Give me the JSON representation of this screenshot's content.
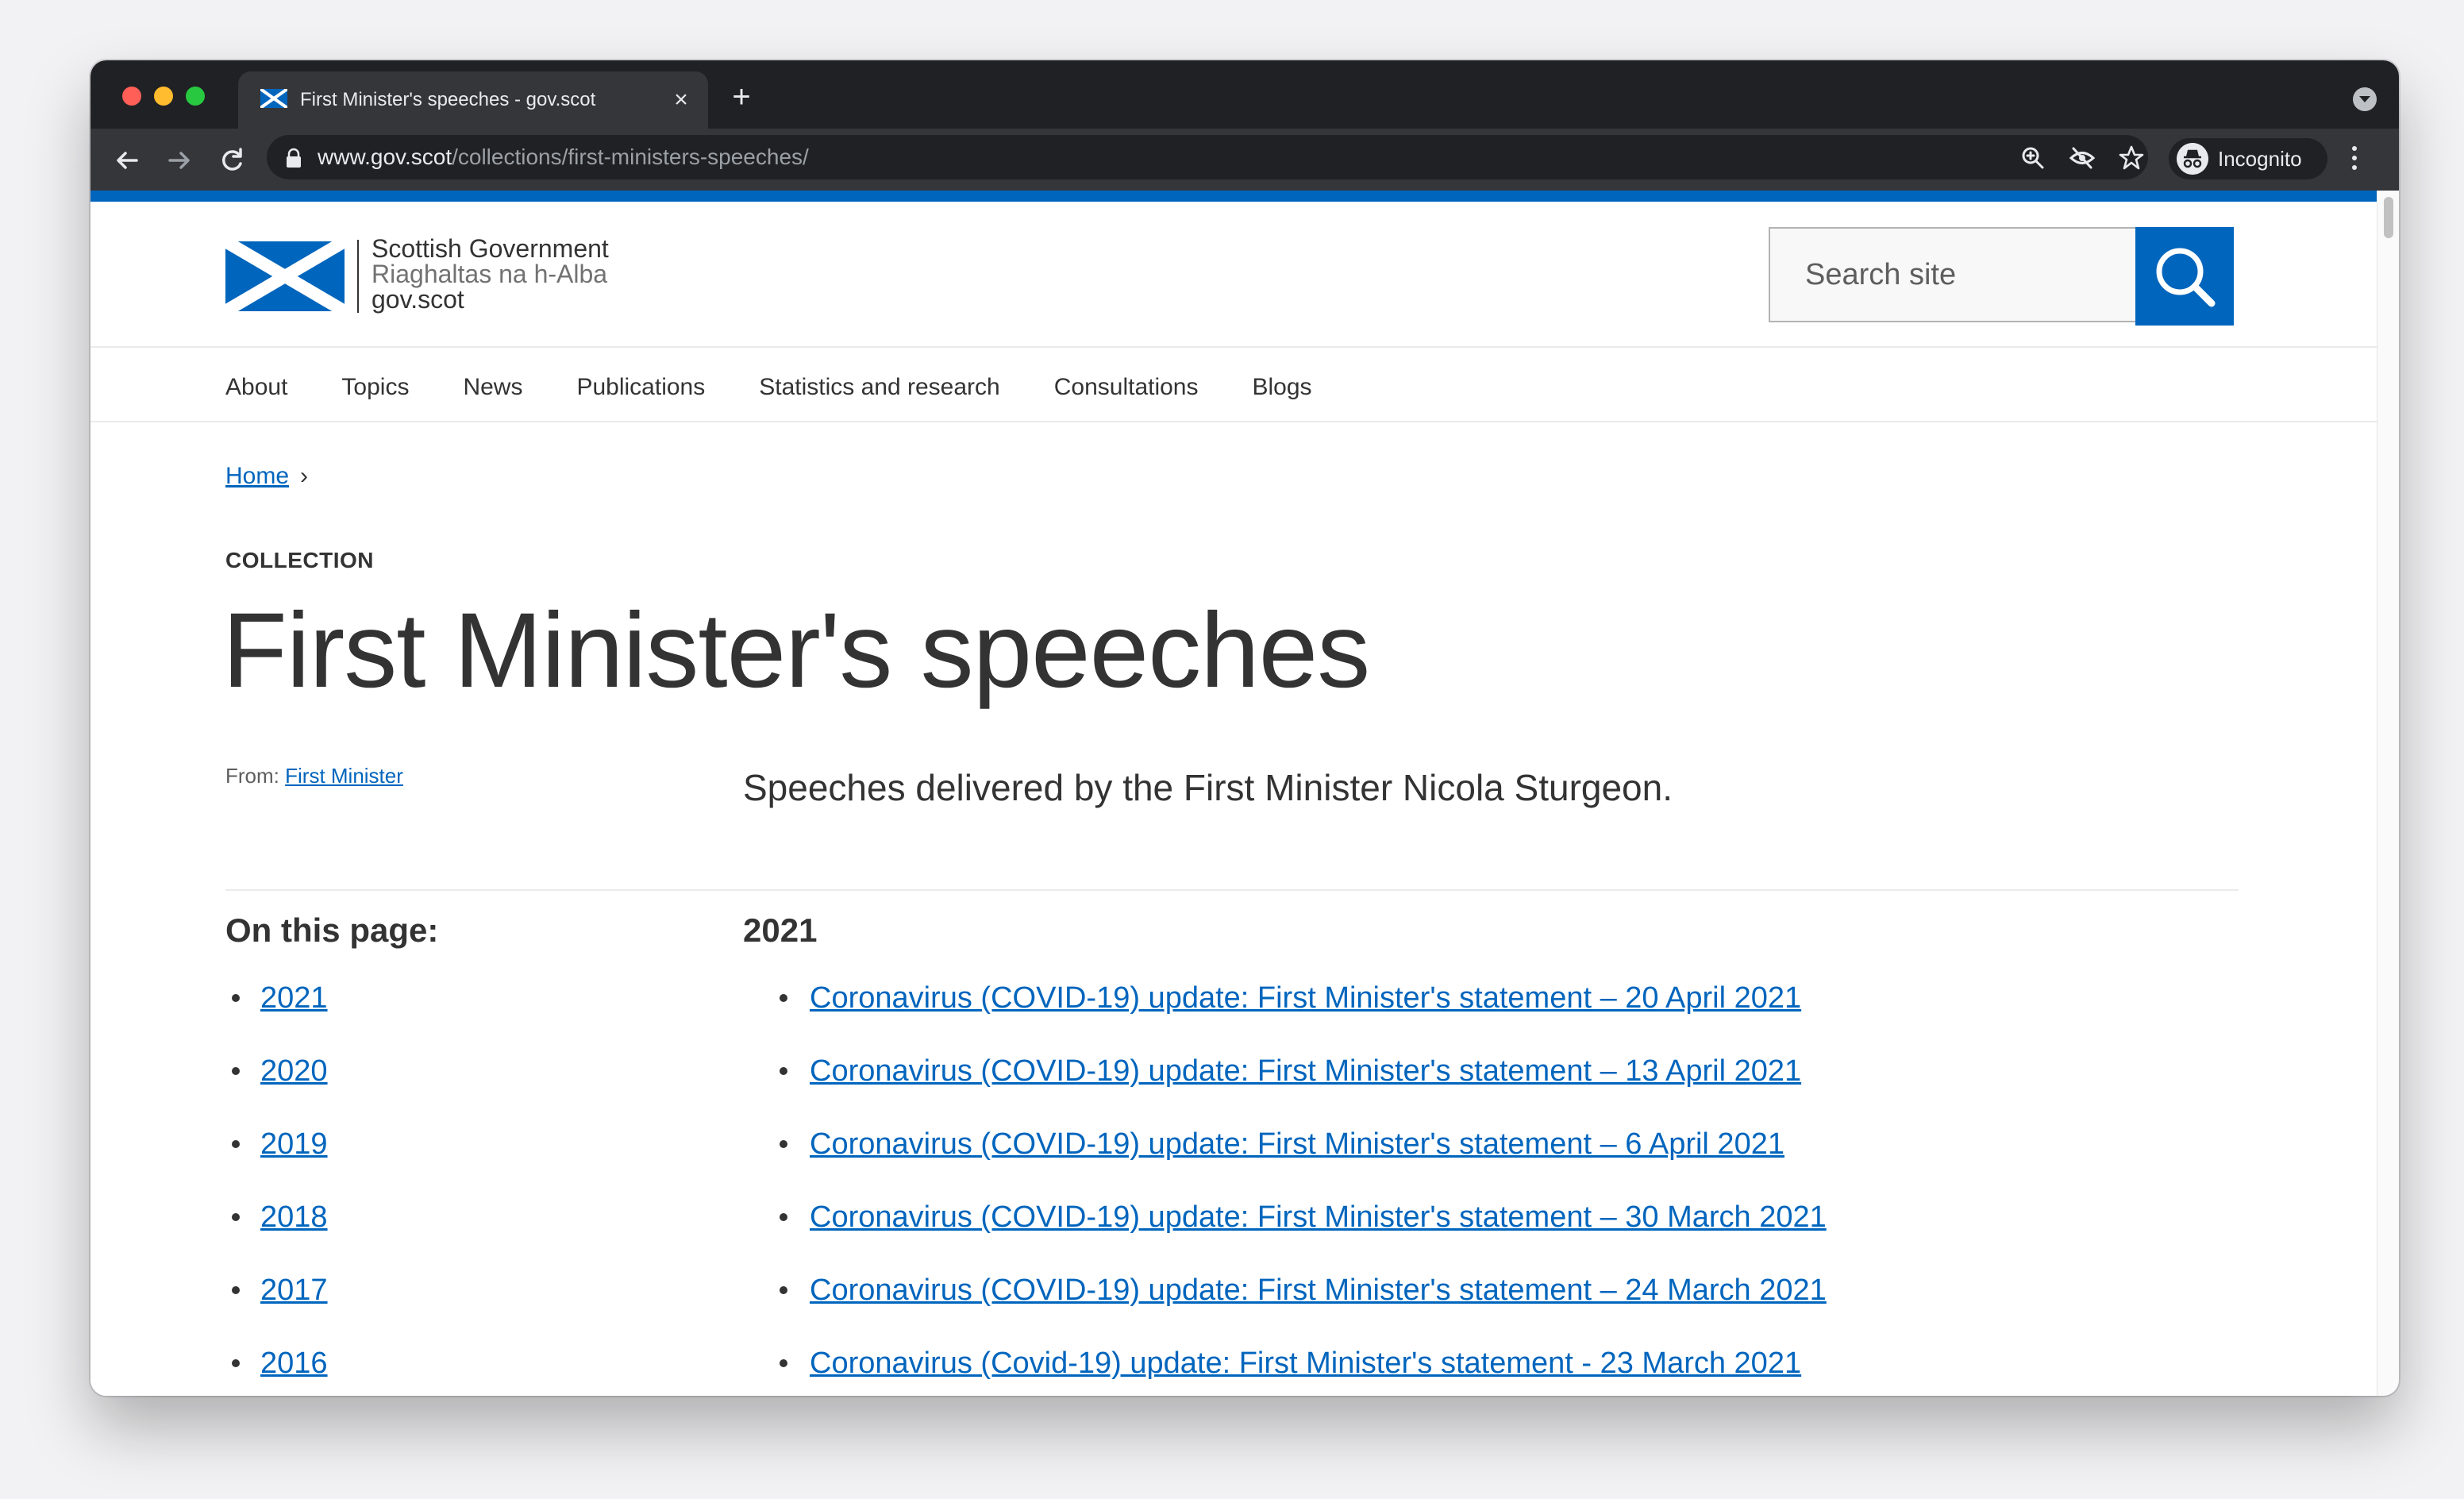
{
  "browser": {
    "tab_title": "First Minister's speeches - gov.scot",
    "url_host": "www.gov.scot",
    "url_path": "/collections/first-ministers-speeches/",
    "profile_label": "Incognito",
    "icons": [
      "back-arrow-icon",
      "forward-arrow-icon",
      "reload-icon",
      "lock-icon",
      "zoom-icon",
      "tracking-protection-icon",
      "bookmark-star-icon",
      "incognito-icon",
      "menu-icon"
    ]
  },
  "site": {
    "logo_line1": "Scottish Government",
    "logo_line2": "Riaghaltas na h-Alba",
    "logo_line3": "gov.scot",
    "search_placeholder": "Search site",
    "accent_color": "#0065bd",
    "nav": [
      "About",
      "Topics",
      "News",
      "Publications",
      "Statistics and research",
      "Consultations",
      "Blogs"
    ]
  },
  "breadcrumb": {
    "home": "Home",
    "separator": "›"
  },
  "page": {
    "label": "COLLECTION",
    "title": "First Minister's speeches",
    "from_label": "From:",
    "from_link": "First Minister",
    "summary": "Speeches delivered by the First Minister Nicola Sturgeon."
  },
  "toc": {
    "heading": "On this page:",
    "items": [
      "2021",
      "2020",
      "2019",
      "2018",
      "2017",
      "2016"
    ]
  },
  "section": {
    "heading": "2021",
    "speeches": [
      "Coronavirus (COVID-19) update: First Minister's statement – 20 April 2021",
      "Coronavirus (COVID-19) update: First Minister's statement – 13 April 2021",
      "Coronavirus (COVID-19) update: First Minister's statement – 6 April 2021",
      "Coronavirus (COVID-19) update: First Minister's statement – 30 March 2021",
      "Coronavirus (COVID-19) update: First Minister's statement – 24 March 2021",
      "Coronavirus (Covid-19) update: First Minister's statement - 23 March 2021"
    ]
  }
}
